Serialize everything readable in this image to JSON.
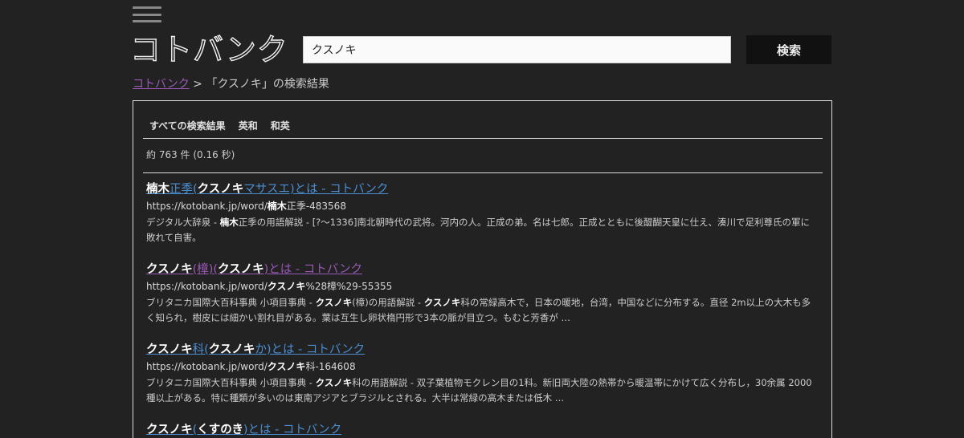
{
  "logo": "コトバンク",
  "search": {
    "value": "クスノキ",
    "button_label": "検索"
  },
  "breadcrumb": {
    "home": "コトバンク",
    "separator": " > ",
    "current": "「クスノキ」の検索結果"
  },
  "tabs": [
    "すべての検索結果",
    "英和",
    "和英"
  ],
  "stats": "約 763 件 (0.16 秒)",
  "colors": {
    "background": "#222222",
    "link": "#4a8fd4",
    "visited_link": "#9b59b6",
    "button": "#111111"
  },
  "results": [
    {
      "title_parts": [
        {
          "t": "楠木",
          "b": true
        },
        {
          "t": "正季(",
          "b": false
        },
        {
          "t": "クスノキ",
          "b": true
        },
        {
          "t": "マサスエ)とは - コトバンク",
          "b": false
        }
      ],
      "url_parts": [
        {
          "t": "https://kotobank.jp/word/",
          "b": false
        },
        {
          "t": "楠木",
          "b": true
        },
        {
          "t": "正季-483568",
          "b": false
        }
      ],
      "snippet_parts": [
        {
          "t": "デジタル大辞泉 - ",
          "b": false
        },
        {
          "t": "楠木",
          "b": true
        },
        {
          "t": "正季の用語解説 - [?～1336]南北朝時代の武将。河内の人。正成の弟。名は七郎。正成とともに後醍醐天皇に仕え、湊川で足利尊氏の軍に敗れて自害。",
          "b": false
        }
      ]
    },
    {
      "title_parts": [
        {
          "t": "クスノキ",
          "b": true
        },
        {
          "t": "(樟)(",
          "b": false
        },
        {
          "t": "クスノキ",
          "b": true
        },
        {
          "t": ")とは - コトバンク",
          "b": false
        }
      ],
      "url_parts": [
        {
          "t": "https://kotobank.jp/word/",
          "b": false
        },
        {
          "t": "クスノキ",
          "b": true
        },
        {
          "t": "%28樟%29-55355",
          "b": false
        }
      ],
      "snippet_parts": [
        {
          "t": "ブリタニカ国際大百科事典 小項目事典 - ",
          "b": false
        },
        {
          "t": "クスノキ",
          "b": true
        },
        {
          "t": "(樟)の用語解説 - ",
          "b": false
        },
        {
          "t": "クスノキ",
          "b": true
        },
        {
          "t": "科の常緑高木で，日本の暖地，台湾，中国などに分布する。直径 2m以上の大木も多く知られ，樹皮には細かい割れ目がある。葉は互生し卵状楕円形で3本の脈が目立つ。もむと芳香が …",
          "b": false
        }
      ]
    },
    {
      "title_parts": [
        {
          "t": "クスノキ",
          "b": true
        },
        {
          "t": "科(",
          "b": false
        },
        {
          "t": "クスノキ",
          "b": true
        },
        {
          "t": "か)とは - コトバンク",
          "b": false
        }
      ],
      "url_parts": [
        {
          "t": "https://kotobank.jp/word/",
          "b": false
        },
        {
          "t": "クスノキ",
          "b": true
        },
        {
          "t": "科-164608",
          "b": false
        }
      ],
      "snippet_parts": [
        {
          "t": "ブリタニカ国際大百科事典 小項目事典 - ",
          "b": false
        },
        {
          "t": "クスノキ",
          "b": true
        },
        {
          "t": "科の用語解説 - 双子葉植物モクレン目の1科。新旧両大陸の熱帯から暖温帯にかけて広く分布し，30余属 2000種以上がある。特に種類が多いのは東南アジアとブラジルとされる。大半は常緑の高木または低木 …",
          "b": false
        }
      ]
    },
    {
      "title_parts": [
        {
          "t": "クスノキ",
          "b": true
        },
        {
          "t": "(",
          "b": false
        },
        {
          "t": "くすのき",
          "b": true
        },
        {
          "t": ")とは - コトバンク",
          "b": false
        }
      ],
      "url_parts": [],
      "snippet_parts": []
    }
  ]
}
